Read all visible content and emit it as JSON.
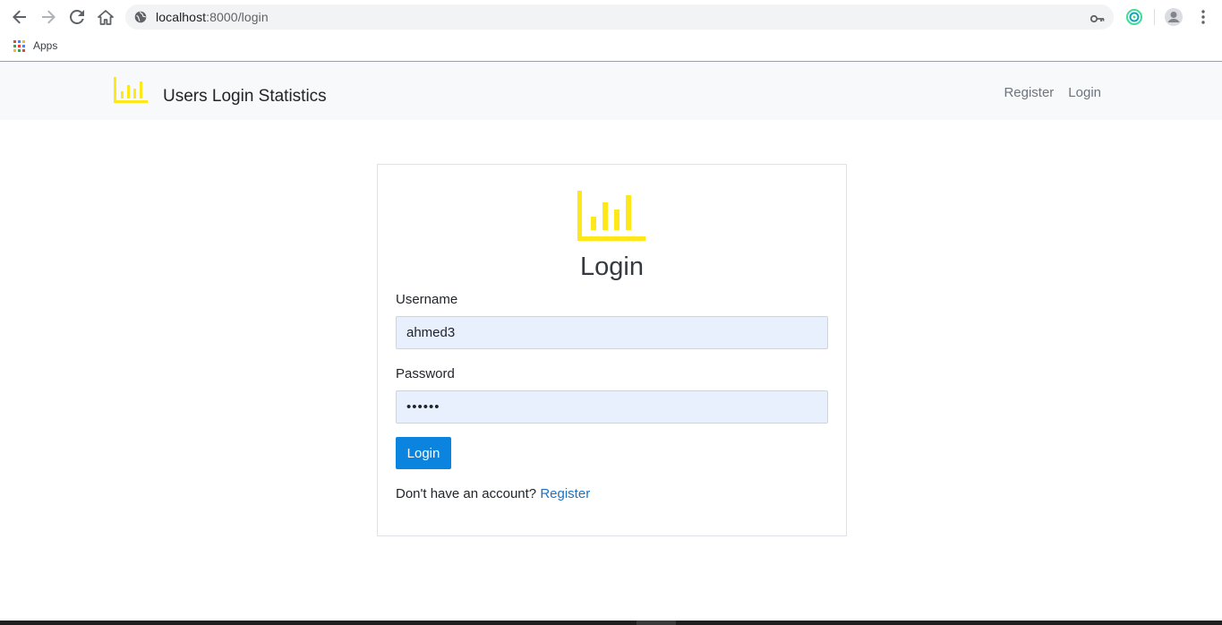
{
  "browser": {
    "url_host": "localhost",
    "url_path": ":8000/login",
    "bookmarks": {
      "apps_label": "Apps"
    }
  },
  "navbar": {
    "brand_title": "Users Login Statistics",
    "links": [
      "Register",
      "Login"
    ],
    "brand_color": "#ffe81a"
  },
  "login_form": {
    "title": "Login",
    "username_label": "Username",
    "username_value": "ahmed3",
    "password_label": "Password",
    "password_value": "••••••",
    "submit_label": "Login",
    "footer_prompt": "Don't have an account?",
    "footer_link": "Register",
    "button_color": "#0a84de",
    "input_bg": "#e8f0fe"
  }
}
